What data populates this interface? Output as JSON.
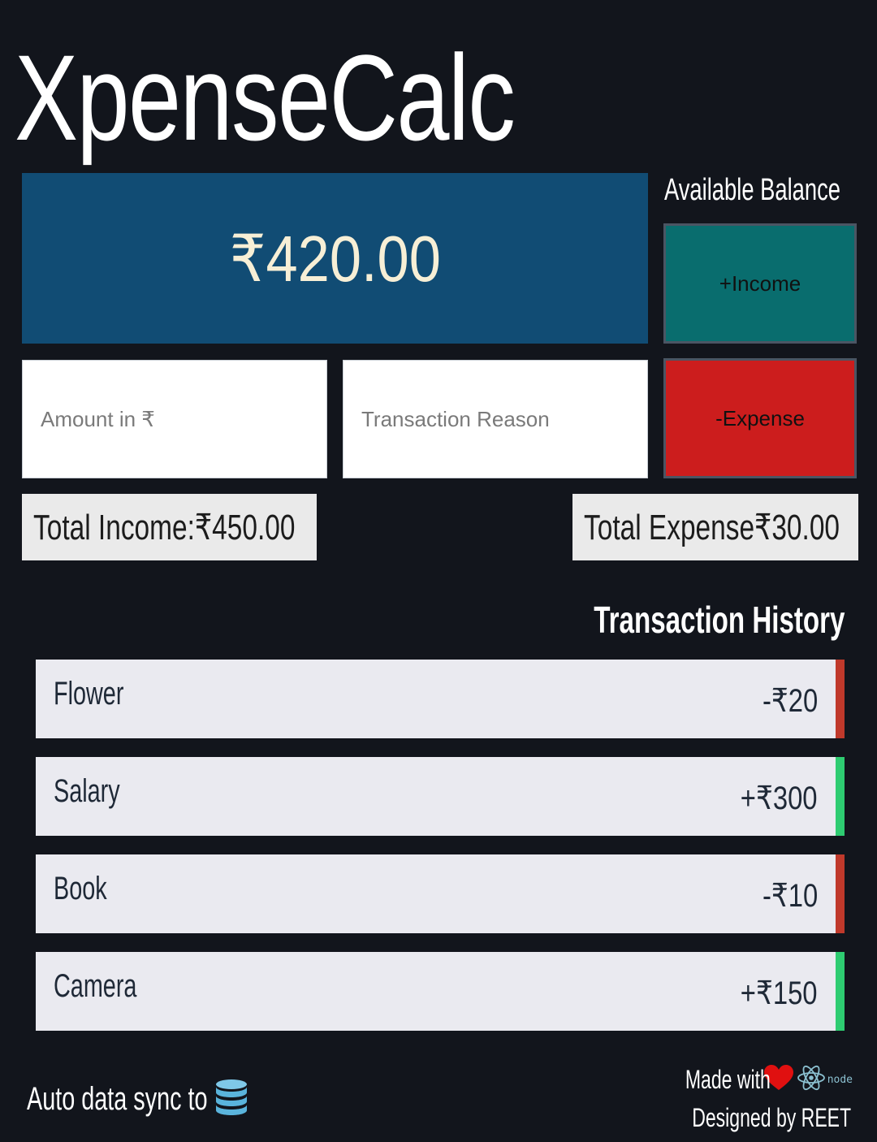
{
  "app": {
    "title": "XpenseCalc"
  },
  "balance": {
    "label": "Available Balance",
    "value": "₹420.00"
  },
  "buttons": {
    "income_label": "+Income",
    "expense_label": "-Expense"
  },
  "inputs": {
    "amount_placeholder": "Amount in ₹",
    "reason_placeholder": "Transaction Reason"
  },
  "totals": {
    "income": "Total Income:₹450.00",
    "expense": "Total Expense₹30.00"
  },
  "history": {
    "heading": "Transaction History",
    "items": [
      {
        "reason": "Flower",
        "amount": "-₹20",
        "type": "expense"
      },
      {
        "reason": "Salary",
        "amount": "+₹300",
        "type": "income"
      },
      {
        "reason": "Book",
        "amount": "-₹10",
        "type": "expense"
      },
      {
        "reason": "Camera",
        "amount": "+₹150",
        "type": "income"
      }
    ]
  },
  "footer": {
    "sync_text": "Auto data sync to",
    "made_with": "Made with",
    "designed_by": "Designed by REET",
    "node_label": "node"
  },
  "colors": {
    "background": "#12151c",
    "balance_card": "#114c74",
    "income_button": "#096d6e",
    "expense_button": "#cc1d1d",
    "income_marker": "#2ecc71",
    "expense_marker": "#c0392b"
  }
}
